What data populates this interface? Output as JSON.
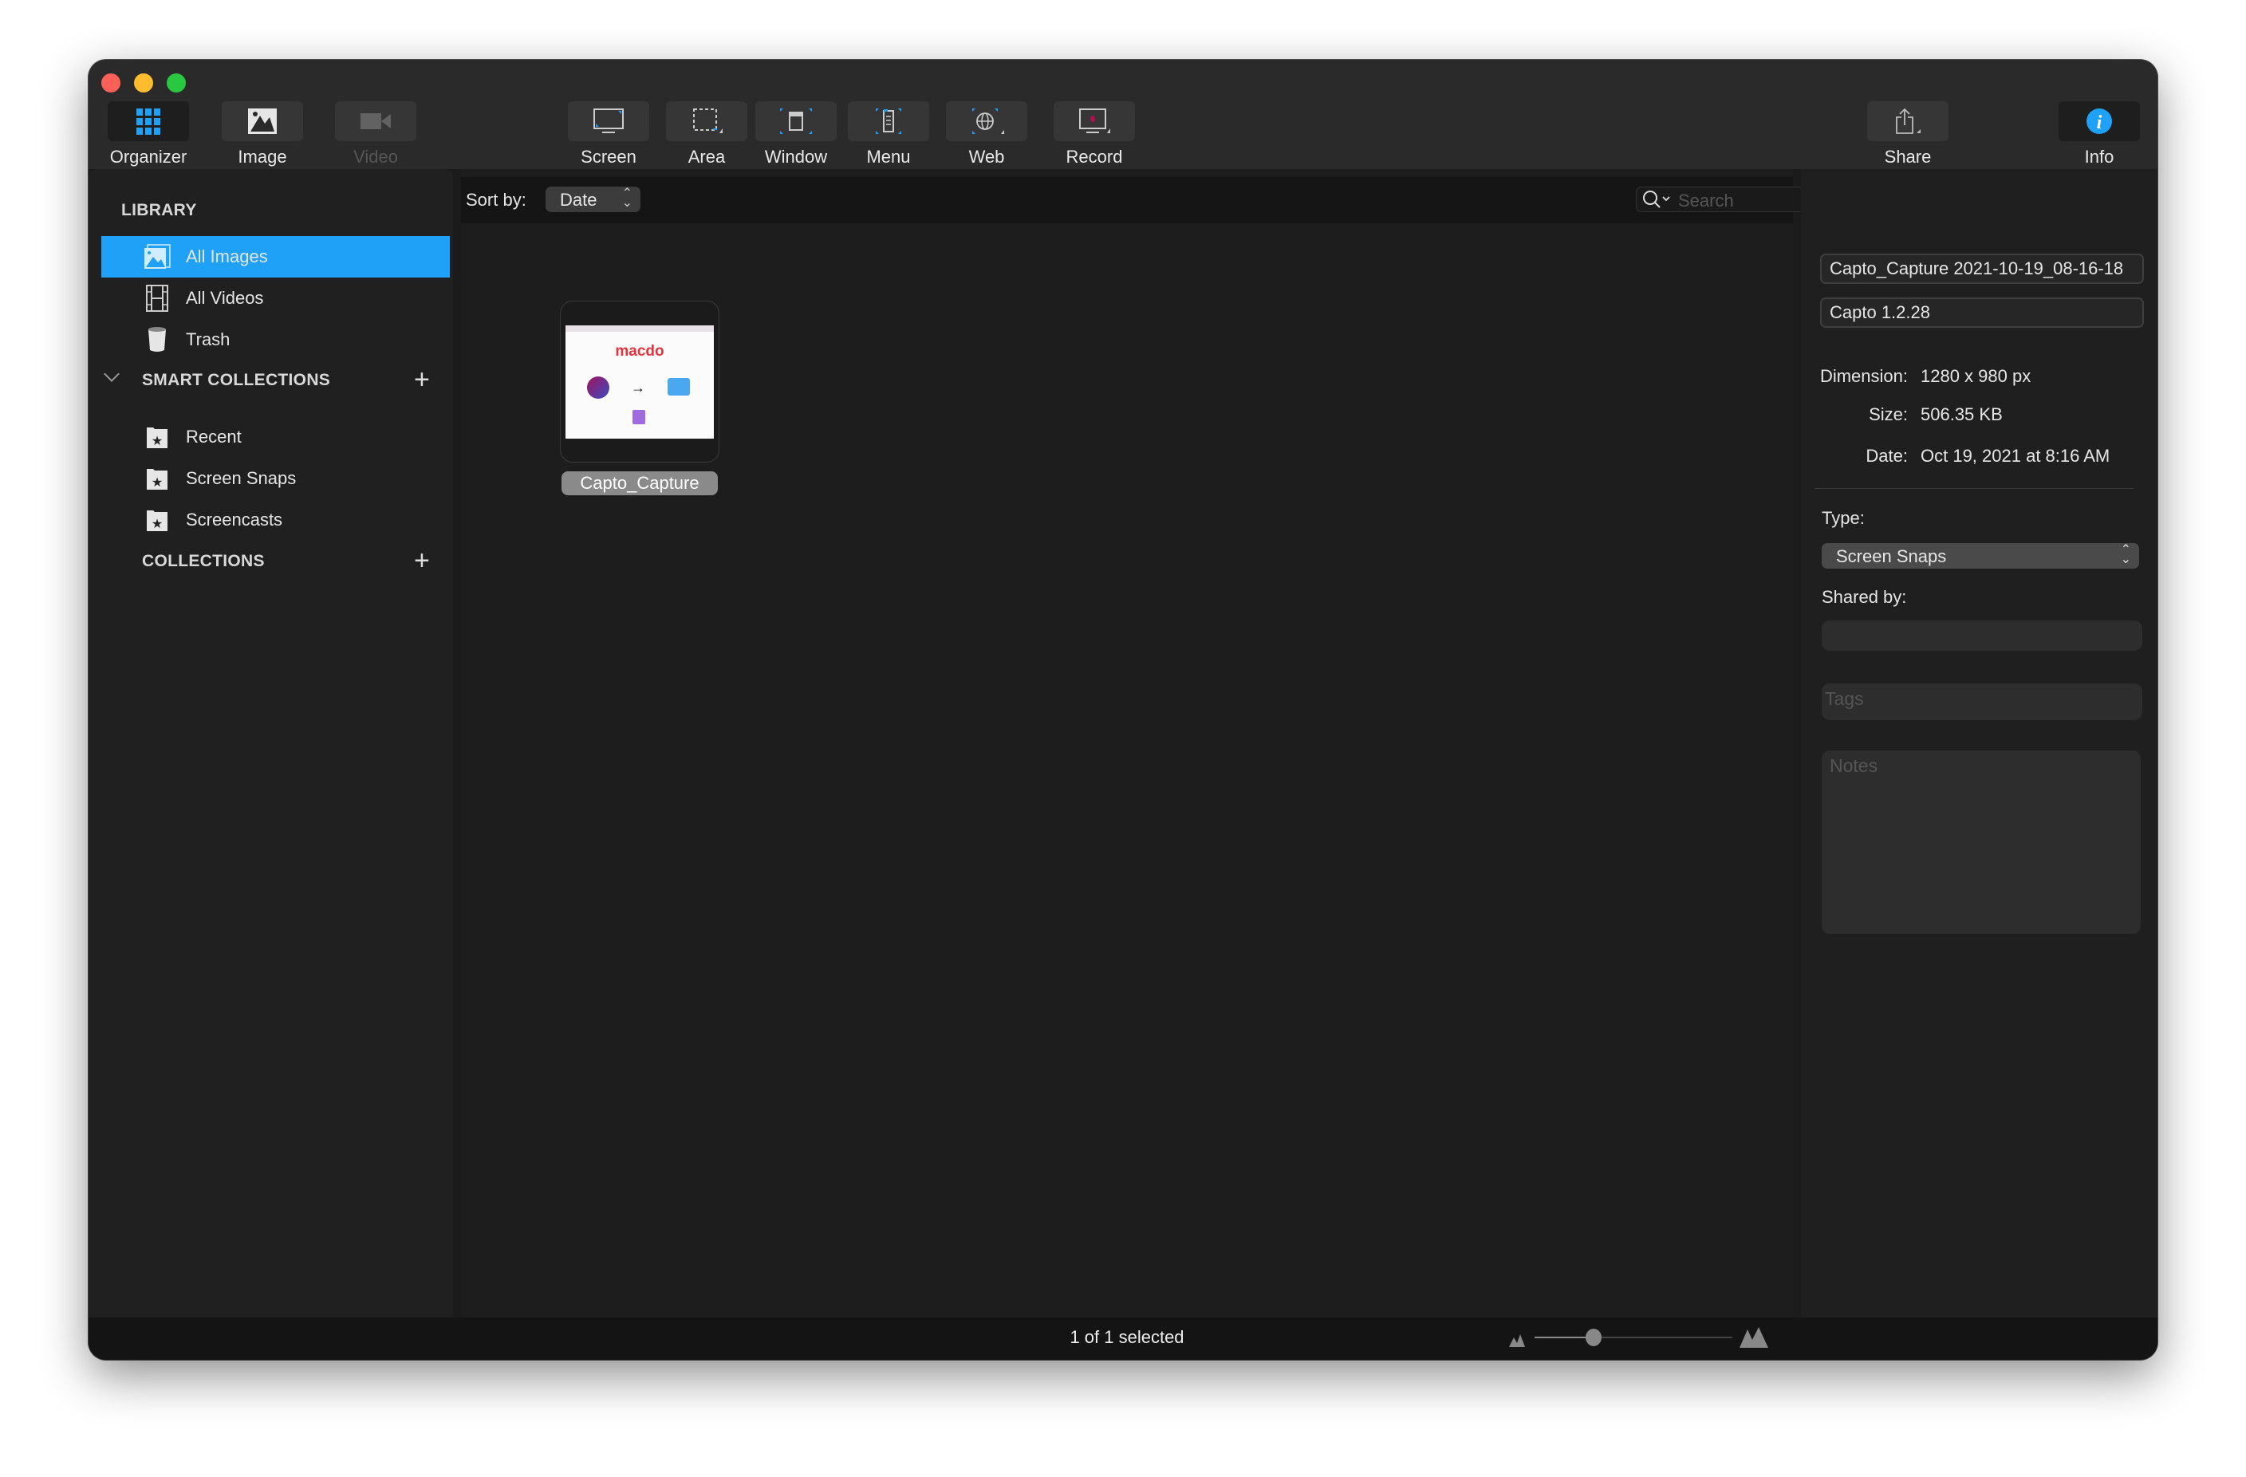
{
  "toolbar": {
    "buttons": [
      {
        "id": "organizer",
        "label": "Organizer",
        "icon": "grid-icon",
        "active": true
      },
      {
        "id": "image",
        "label": "Image",
        "icon": "image-icon"
      },
      {
        "id": "video",
        "label": "Video",
        "icon": "video-camera-icon",
        "disabled": true
      },
      {
        "id": "screen",
        "label": "Screen",
        "icon": "screen-capture-icon"
      },
      {
        "id": "area",
        "label": "Area",
        "icon": "area-capture-icon"
      },
      {
        "id": "window",
        "label": "Window",
        "icon": "window-capture-icon"
      },
      {
        "id": "menu",
        "label": "Menu",
        "icon": "menu-capture-icon"
      },
      {
        "id": "web",
        "label": "Web",
        "icon": "web-capture-icon"
      },
      {
        "id": "record",
        "label": "Record",
        "icon": "record-icon"
      },
      {
        "id": "share",
        "label": "Share",
        "icon": "share-icon"
      },
      {
        "id": "info",
        "label": "Info",
        "icon": "info-icon",
        "active": true
      }
    ]
  },
  "sidebar": {
    "library_title": "LIBRARY",
    "library": [
      {
        "label": "All Images",
        "icon": "images-icon",
        "selected": true
      },
      {
        "label": "All Videos",
        "icon": "film-icon"
      },
      {
        "label": "Trash",
        "icon": "trash-icon"
      }
    ],
    "smart_title": "SMART COLLECTIONS",
    "smart": [
      {
        "label": "Recent",
        "icon": "smart-folder-icon"
      },
      {
        "label": "Screen Snaps",
        "icon": "smart-folder-icon"
      },
      {
        "label": "Screencasts",
        "icon": "smart-folder-icon"
      }
    ],
    "collections_title": "COLLECTIONS"
  },
  "main": {
    "sort_label": "Sort by:",
    "sort_value": "Date",
    "search_placeholder": "Search",
    "items": [
      {
        "name": "Capto_Capture",
        "thumb_text": "macdo",
        "selected": true
      }
    ],
    "status": "1 of 1 selected",
    "zoom_level": 0.3
  },
  "info": {
    "name": "Capto_Capture 2021-10-19_08-16-18",
    "app": "Capto 1.2.28",
    "dimension_label": "Dimension:",
    "dimension": "1280 x 980 px",
    "size_label": "Size:",
    "size": "506.35 KB",
    "date_label": "Date:",
    "date": "Oct 19, 2021 at 8:16 AM",
    "type_label": "Type:",
    "type_value": "Screen Snaps",
    "shared_label": "Shared by:",
    "shared_value": "",
    "tags_placeholder": "Tags",
    "notes_placeholder": "Notes"
  },
  "colors": {
    "accent": "#1ea1f7",
    "close": "#fe5f57",
    "minimize": "#febc2e",
    "zoom": "#28c840"
  }
}
